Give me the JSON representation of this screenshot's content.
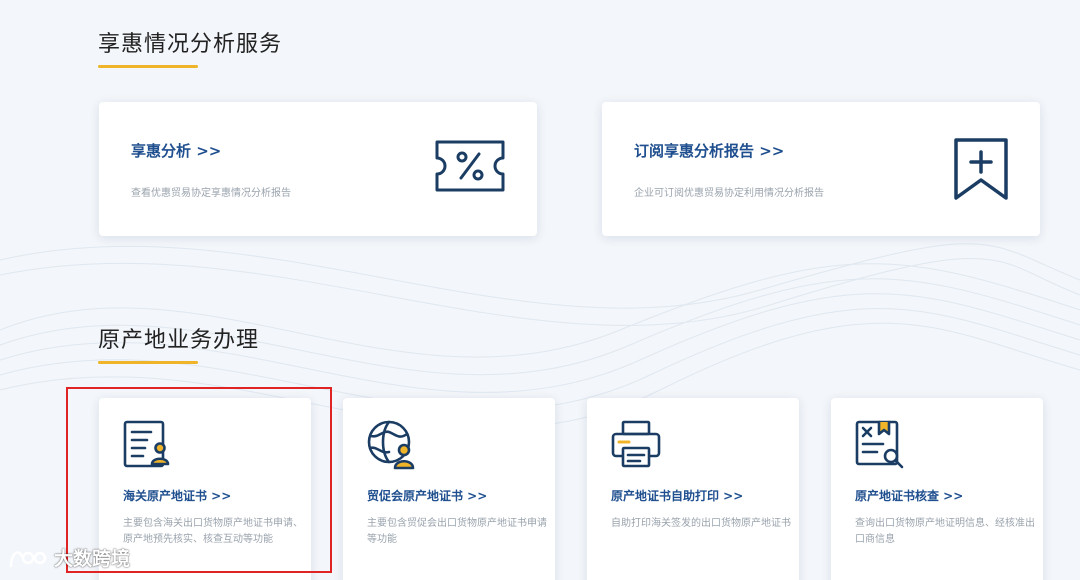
{
  "sections": {
    "analysis": {
      "title": "享惠情况分析服务"
    },
    "origin": {
      "title": "原产地业务办理"
    }
  },
  "analysis_cards": [
    {
      "title": "享惠分析 >>",
      "desc": "查看优惠贸易协定享惠情况分析报告",
      "icon": "percent-ticket-icon"
    },
    {
      "title": "订阅享惠分析报告 >>",
      "desc": "企业可订阅优惠贸易协定利用情况分析报告",
      "icon": "bookmark-plus-icon"
    }
  ],
  "origin_cards": [
    {
      "title": "海关原产地证书 >>",
      "desc": "主要包含海关出口货物原产地证书申请、原产地预先核实、核查互动等功能",
      "icon": "certificate-person-icon"
    },
    {
      "title": "贸促会原产地证书 >>",
      "desc": "主要包含贸促会出口货物原产地证书申请等功能",
      "icon": "globe-person-icon"
    },
    {
      "title": "原产地证书自助打印 >>",
      "desc": "自助打印海关签发的出口货物原产地证书",
      "icon": "printer-icon"
    },
    {
      "title": "原产地证书核查 >>",
      "desc": "查询出口货物原产地证明信息、经核准出口商信息",
      "icon": "certificate-search-icon"
    }
  ],
  "colors": {
    "accent": "#f0b429",
    "title_blue": "#1f4f8f",
    "highlight": "#e02424"
  },
  "watermark": {
    "text": "大数跨境"
  }
}
